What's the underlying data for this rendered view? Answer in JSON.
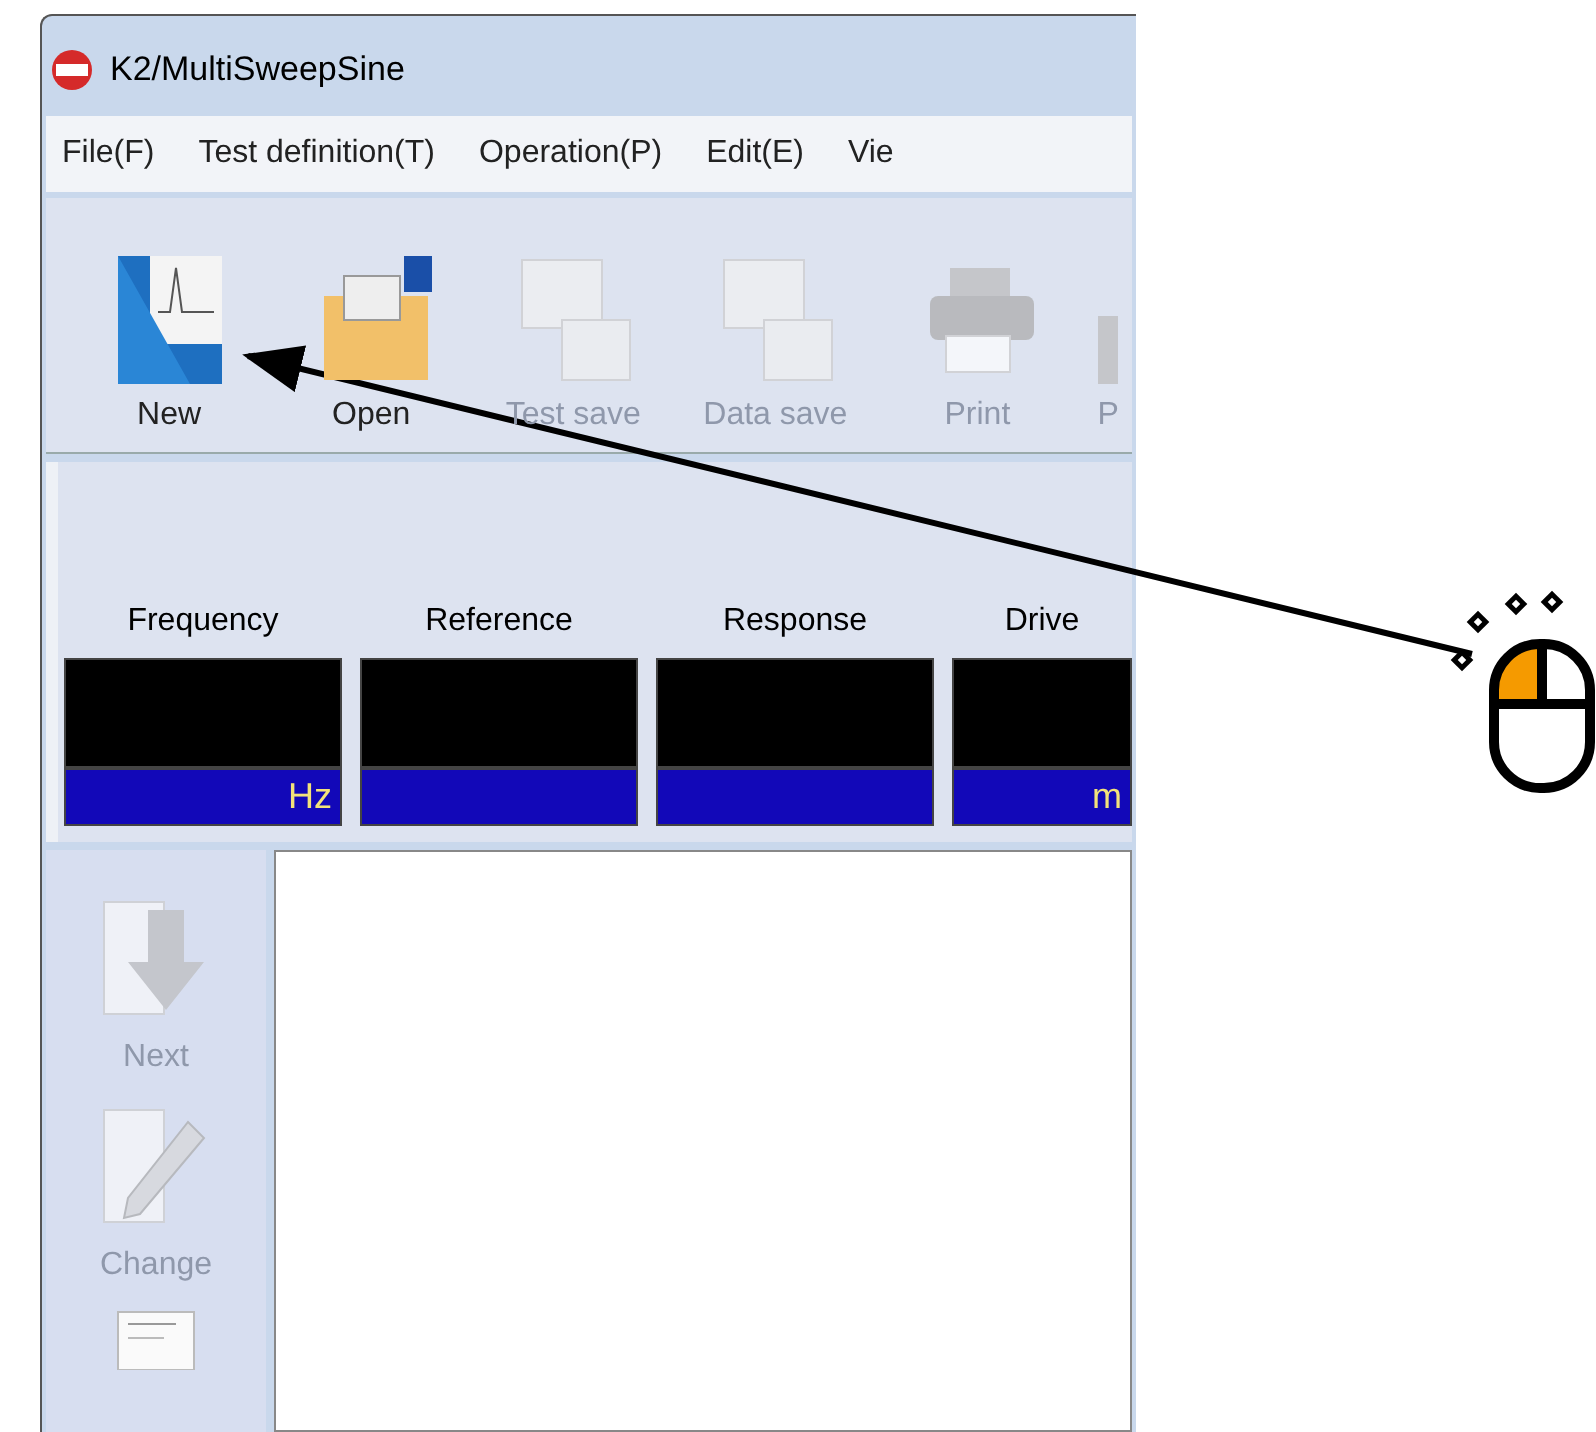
{
  "window": {
    "title": "K2/MultiSweepSine"
  },
  "menu": [
    {
      "label": "File(F)"
    },
    {
      "label": "Test definition(T)"
    },
    {
      "label": "Operation(P)"
    },
    {
      "label": "Edit(E)"
    },
    {
      "label": "Vie"
    }
  ],
  "toolbar": [
    {
      "label": "New",
      "kind": "new",
      "disabled": false
    },
    {
      "label": "Open",
      "kind": "open",
      "disabled": false
    },
    {
      "label": "Test save",
      "kind": "testsave",
      "disabled": true
    },
    {
      "label": "Data save",
      "kind": "datasave",
      "disabled": true
    },
    {
      "label": "Print",
      "kind": "print",
      "disabled": true
    },
    {
      "label": "P",
      "kind": "partial",
      "disabled": true
    }
  ],
  "meters": [
    {
      "label": "Frequency",
      "unit": "Hz"
    },
    {
      "label": "Reference"
    },
    {
      "label": "Response"
    },
    {
      "label": "Drive",
      "unit": "m"
    }
  ],
  "side_toolbar": [
    {
      "label": "Next",
      "kind": "next",
      "disabled": true
    },
    {
      "label": "Change",
      "kind": "change",
      "disabled": true
    },
    {
      "kind": "partialdoc"
    }
  ]
}
